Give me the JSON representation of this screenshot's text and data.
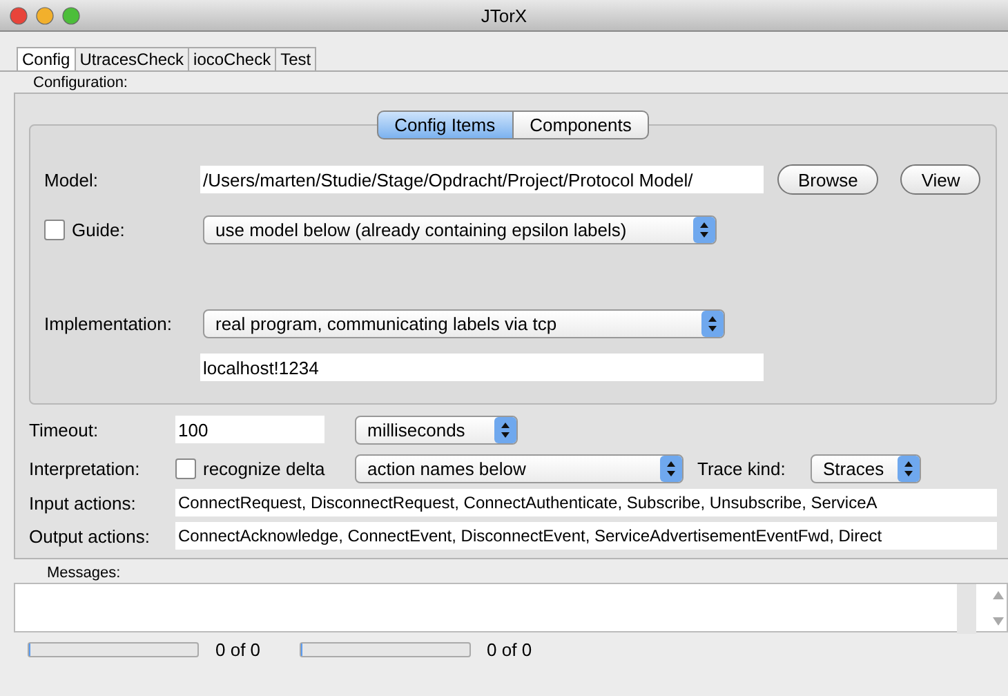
{
  "window": {
    "title": "JTorX"
  },
  "tabs": [
    {
      "label": "Config",
      "selected": true
    },
    {
      "label": "UtracesCheck",
      "selected": false
    },
    {
      "label": "iocoCheck",
      "selected": false
    },
    {
      "label": "Test",
      "selected": false
    }
  ],
  "section_label": "Configuration:",
  "segments": [
    {
      "label": "Config Items",
      "selected": true
    },
    {
      "label": "Components",
      "selected": false
    }
  ],
  "model": {
    "label": "Model:",
    "value": "/Users/marten/Studie/Stage/Opdracht/Project/Protocol Model/",
    "buttons": [
      "Browse",
      "View"
    ]
  },
  "guide": {
    "label": "Guide:",
    "checked": false,
    "dropdown": "use model below (already containing epsilon labels)"
  },
  "implementation": {
    "label": "Implementation:",
    "dropdown": "real program, communicating labels via tcp",
    "address": "localhost!1234"
  },
  "timeout": {
    "label": "Timeout:",
    "value": "100",
    "unit": "milliseconds"
  },
  "interpretation": {
    "label": "Interpretation:",
    "checkbox_label": "recognize delta",
    "checked": false,
    "dropdown": "action names below",
    "trace_kind_label": "Trace kind:",
    "trace_kind": "Straces"
  },
  "input_actions": {
    "label": "Input actions:",
    "value": "ConnectRequest, DisconnectRequest, ConnectAuthenticate, Subscribe, Unsubscribe, ServiceA"
  },
  "output_actions": {
    "label": "Output actions:",
    "value": "ConnectAcknowledge, ConnectEvent, DisconnectEvent, ServiceAdvertisementEventFwd, Direct"
  },
  "messages": {
    "label": "Messages:"
  },
  "progress": [
    {
      "level": 0,
      "reading": "0 of 0"
    },
    {
      "level": 0,
      "reading": "0 of 0"
    }
  ]
}
